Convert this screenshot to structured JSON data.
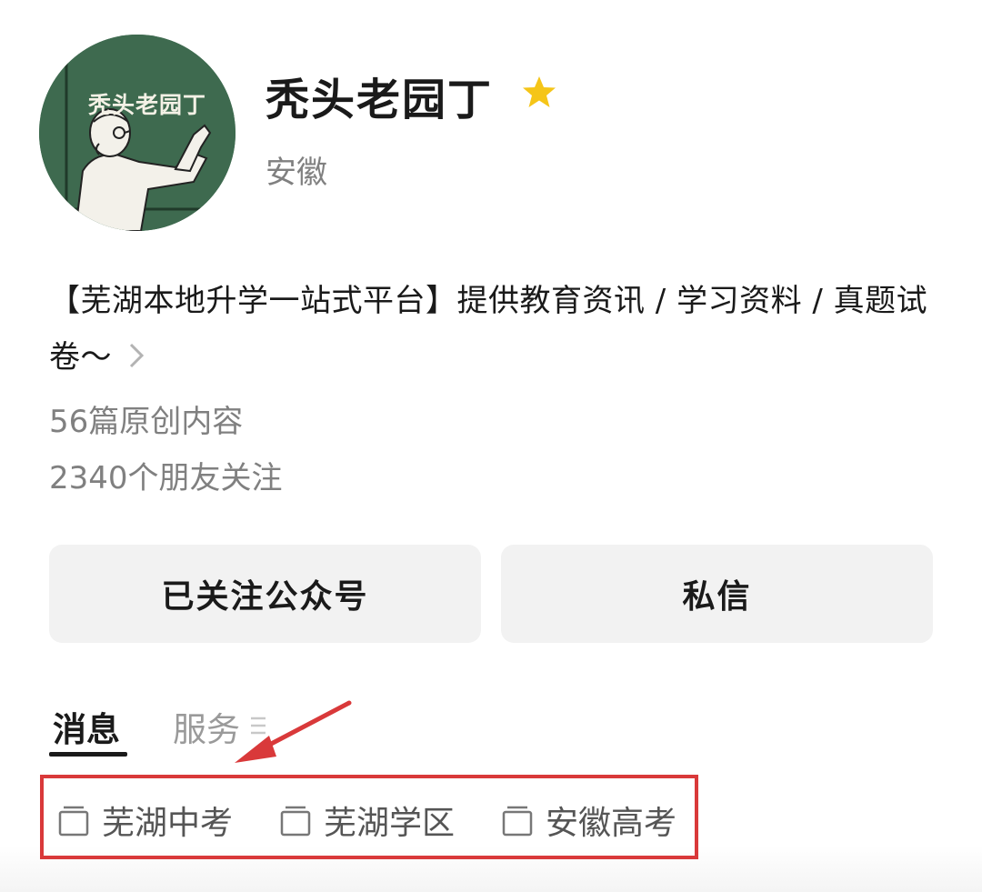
{
  "profile": {
    "name": "秃头老园丁",
    "location": "安徽",
    "avatar_text": "秃头老园丁",
    "bio": "【芜湖本地升学一站式平台】提供教育资讯 / 学习资料 / 真题试卷～",
    "original_count": "56篇原创内容",
    "followers": "2340个朋友关注"
  },
  "buttons": {
    "follow": "已关注公众号",
    "message": "私信"
  },
  "tabs": [
    {
      "label": "消息",
      "active": true
    },
    {
      "label": "服务",
      "active": false
    }
  ],
  "collections": [
    {
      "label": "芜湖中考",
      "icon": "folder-icon"
    },
    {
      "label": "芜湖学区",
      "icon": "folder-icon"
    },
    {
      "label": "安徽高考",
      "icon": "folder-icon"
    }
  ],
  "colors": {
    "highlight": "#d9393a",
    "star": "#f5c518",
    "avatar_bg": "#3e6a4f"
  }
}
